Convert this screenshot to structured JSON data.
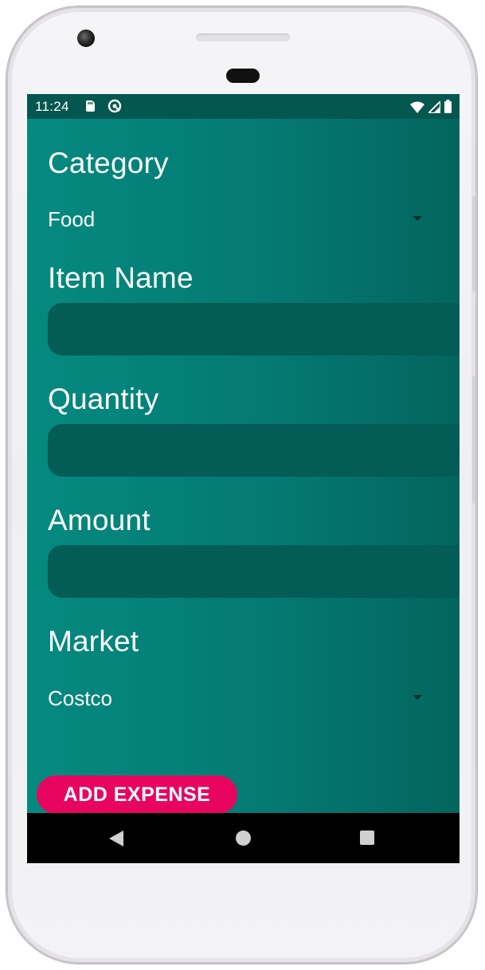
{
  "status_bar": {
    "time": "11:24",
    "icons": [
      "sd-card-icon",
      "sync-icon",
      "wifi-icon",
      "cell-signal-icon",
      "battery-icon"
    ]
  },
  "form": {
    "category": {
      "label": "Category",
      "selected": "Food"
    },
    "item_name": {
      "label": "Item Name",
      "value": ""
    },
    "quantity": {
      "label": "Quantity",
      "value": ""
    },
    "amount": {
      "label": "Amount",
      "value": ""
    },
    "market": {
      "label": "Market",
      "selected": "Costco"
    },
    "submit_label": "ADD EXPENSE"
  },
  "nav": {
    "icons": [
      "back-icon",
      "home-icon",
      "recents-icon"
    ]
  },
  "colors": {
    "status_bar": "#04574f",
    "background": "#058a80",
    "input_fill": "#045c56",
    "accent": "#e8055f",
    "nav_bar": "#000000"
  }
}
